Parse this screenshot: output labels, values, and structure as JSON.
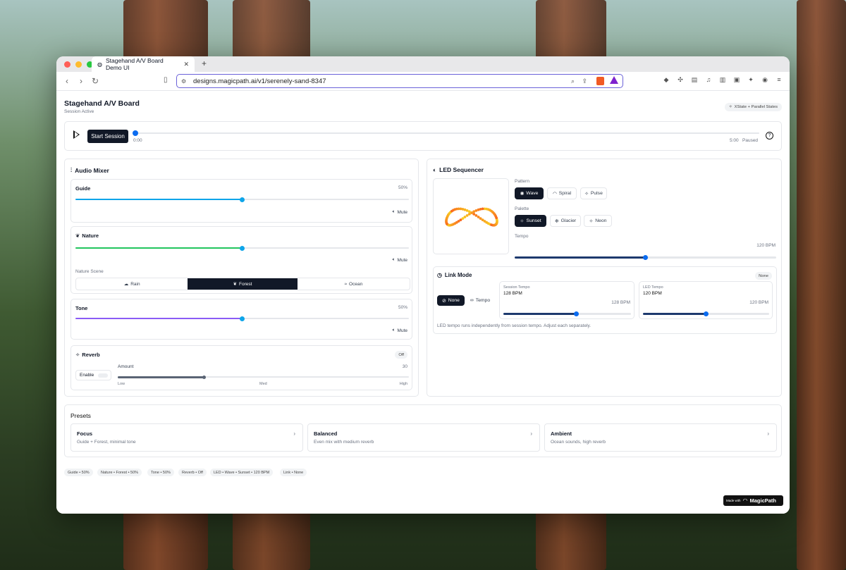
{
  "browser": {
    "tab_title": "Stagehand A/V Board Demo UI",
    "url": "designs.magicpath.ai/v1/serenely-sand-8347",
    "colors": {
      "close": "#ff5f57",
      "minimize": "#febc2e",
      "maximize": "#28c840",
      "url_border": "#6b62d9"
    }
  },
  "header": {
    "title": "Stagehand A/V Board",
    "subtitle": "Session Active",
    "chip_label": "XState + Parallel States"
  },
  "transport": {
    "start_label": "Start Session",
    "time_current": "0:00",
    "time_total": "5:00",
    "state": "Paused",
    "progress": 0
  },
  "mixer": {
    "title": "Audio Mixer",
    "guide": {
      "label": "Guide",
      "value": "50%",
      "level": 0.5,
      "mute": "Mute",
      "color": "#0ea5e9"
    },
    "nature": {
      "label": "Nature",
      "level": 0.5,
      "mute": "Mute",
      "color": "#22c55e",
      "scene_label": "Nature Scene",
      "scenes": [
        "Rain",
        "Forest",
        "Ocean"
      ],
      "selected_scene": "Forest"
    },
    "tone": {
      "label": "Tone",
      "value": "50%",
      "level": 0.5,
      "mute": "Mute",
      "color": "#8b5cf6"
    },
    "reverb": {
      "label": "Reverb",
      "badge": "Off",
      "enable_label": "Enable",
      "amount_label": "Amount",
      "amount_value": "30",
      "level": 0.3,
      "low": "Low",
      "med": "Med",
      "high": "High"
    }
  },
  "led": {
    "title": "LED Sequencer",
    "pattern_label": "Pattern",
    "patterns": [
      "Wave",
      "Spiral",
      "Pulse"
    ],
    "selected_pattern": "Wave",
    "palette_label": "Palette",
    "palettes": [
      "Sunset",
      "Glacier",
      "Neon"
    ],
    "selected_palette": "Sunset",
    "tempo_label": "Tempo",
    "tempo_value": "120 BPM",
    "tempo_level": 0.5,
    "link": {
      "title": "Link Mode",
      "badge": "None",
      "options": [
        "None",
        "Tempo"
      ],
      "selected": "None",
      "session_tempo_label": "Session Tempo",
      "session_tempo_value": "128 BPM",
      "session_tempo_right": "128 BPM",
      "session_level": 0.57,
      "led_tempo_label": "LED Tempo",
      "led_tempo_value": "120 BPM",
      "led_tempo_right": "120 BPM",
      "led_level": 0.5,
      "note": "LED tempo runs independently from session tempo. Adjust each separately."
    }
  },
  "presets": {
    "title": "Presets",
    "items": [
      {
        "title": "Focus",
        "desc": "Guide + Forest, minimal tone"
      },
      {
        "title": "Balanced",
        "desc": "Even mix with medium reverb"
      },
      {
        "title": "Ambient",
        "desc": "Ocean sounds, high reverb"
      }
    ]
  },
  "status_chips": [
    "Guide • 50%",
    "Nature • Forest • 50%",
    "Tone • 50%",
    "Reverb • Off",
    "LED • Wave • Sunset • 120 BPM",
    "Link • None"
  ],
  "badge": {
    "made_with": "Made with",
    "brand": "MagicPath"
  }
}
